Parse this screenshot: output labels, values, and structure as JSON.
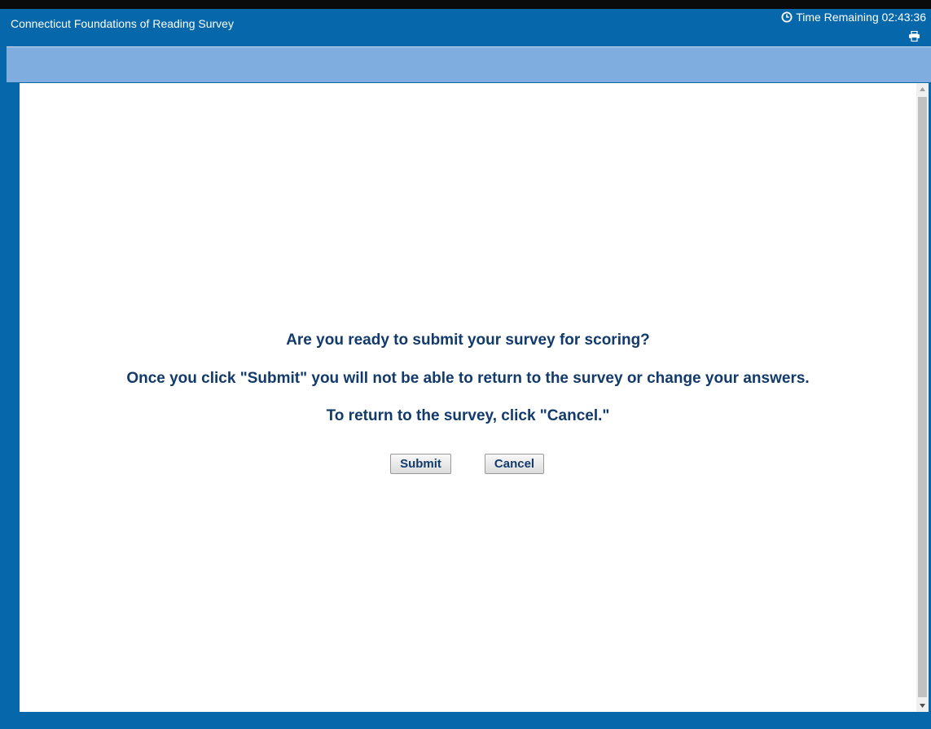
{
  "header": {
    "title": "Connecticut Foundations of Reading Survey",
    "timer_label": "Time Remaining 02:43:36",
    "clock_icon": "clock-icon",
    "print_icon": "print-icon"
  },
  "dialog": {
    "question": "Are you ready to submit your survey for scoring?",
    "warning": "Once you click \"Submit\" you will not be able to return to the survey or change your answers.",
    "instruction": "To return to the survey, click \"Cancel.\"",
    "submit_label": "Submit",
    "cancel_label": "Cancel"
  },
  "colors": {
    "header_blue": "#0668aa",
    "toolbar_blue": "#7fade0",
    "text_navy": "#123a6b"
  }
}
